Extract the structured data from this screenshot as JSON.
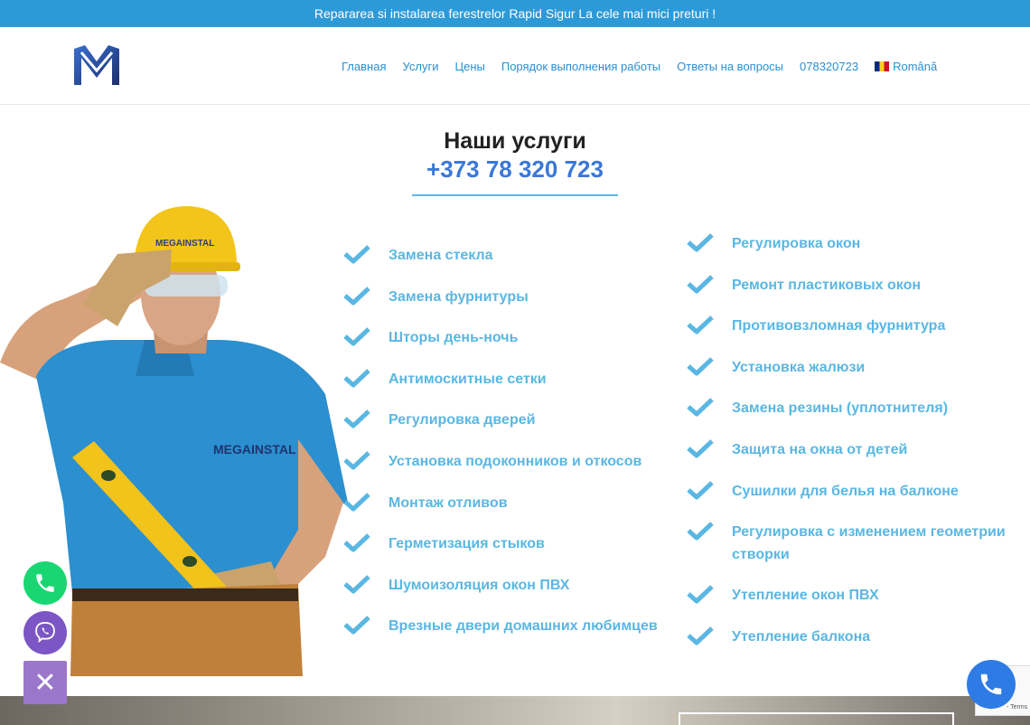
{
  "topbar": {
    "text": "Repararea si instalarea ferestrelor Rapid Sigur La cele mai mici preturi !"
  },
  "nav": {
    "items": [
      {
        "label": "Главная"
      },
      {
        "label": "Услуги"
      },
      {
        "label": "Цены"
      },
      {
        "label": "Порядок выполнения работы"
      },
      {
        "label": "Ответы на вопросы"
      },
      {
        "label": "078320723"
      },
      {
        "label": "Română"
      }
    ]
  },
  "section": {
    "title": "Наши услуги",
    "phone": "+373 78 320 723"
  },
  "services_left": [
    "Замена стекла",
    "Замена фурнитуры",
    "Шторы день-ночь",
    "Антимоскитные сетки",
    "Регулировка дверей",
    "Установка подоконников и откосов",
    "Монтаж отливов",
    "Герметизация стыков",
    "Шумоизоляция окон ПВХ",
    "Врезные двери домашних любимцев"
  ],
  "services_right": [
    "Регулировка окон",
    "Ремонт пластиковых окон",
    "Противовзломная фурнитура",
    "Установка жалюзи",
    "Замена резины (уплотнителя)",
    "Защита на окна от детей",
    "Сушилки для белья на балконе",
    "Регулировка с изменением геометрии створки",
    "Утепление окон ПВХ",
    "Утепление балкона"
  ],
  "worker": {
    "helmet_text": "MEGAINSTAL",
    "shirt_text": "MEGAINSTAL"
  },
  "floating": {
    "close_symbol": "✕"
  },
  "recaptcha": {
    "text": "- Terms"
  },
  "colors": {
    "topbar": "#2d9ad8",
    "accent": "#5ab7e3",
    "phone": "#3a78d8",
    "whatsapp": "#19d672",
    "viber": "#7b56c4"
  }
}
